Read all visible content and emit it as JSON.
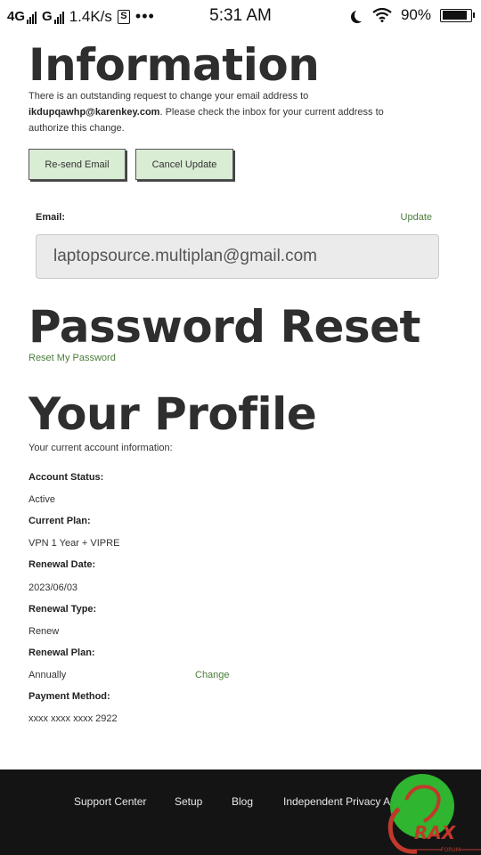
{
  "status_bar": {
    "network_1": "4G",
    "network_2": "G",
    "speed": "1.4K/s",
    "s_icon": "S",
    "dots": "•••",
    "time": "5:31 AM",
    "battery": "90%"
  },
  "information": {
    "title": "Information",
    "notice_pre": "There is an outstanding request to change your email address to",
    "notice_email": "ikdupqawhp@karenkey.com",
    "notice_post": ". Please check the inbox for your current address to authorize this change.",
    "resend_label": "Re-send Email",
    "cancel_label": "Cancel Update"
  },
  "email": {
    "label": "Email:",
    "update_label": "Update",
    "value": "laptopsource.multiplan@gmail.com"
  },
  "password": {
    "title": "Password Reset",
    "reset_label": "Reset My Password"
  },
  "profile": {
    "title": "Your Profile",
    "subtitle": "Your current account information:",
    "fields": [
      {
        "label": "Account Status:",
        "value": "Active"
      },
      {
        "label": "Current Plan:",
        "value": "VPN 1 Year + VIPRE"
      },
      {
        "label": "Renewal Date:",
        "value": "2023/06/03"
      },
      {
        "label": "Renewal Type:",
        "value": "Renew"
      },
      {
        "label": "Renewal Plan:",
        "value": "Annually"
      },
      {
        "label": "Payment Method:",
        "value": "xxxx xxxx xxxx 2922"
      }
    ],
    "change_label": "Change"
  },
  "footer": {
    "links": [
      "Support Center",
      "Setup",
      "Blog",
      "Independent Privacy Au"
    ]
  },
  "logo": {
    "text": "RAX",
    "subtext": "FORUM"
  },
  "colors": {
    "accent_green": "#4a7d3a",
    "button_bg": "#d9ecd4",
    "footer_bg": "#141414",
    "logo_green": "#2fb52f",
    "logo_red": "#c0392b"
  }
}
